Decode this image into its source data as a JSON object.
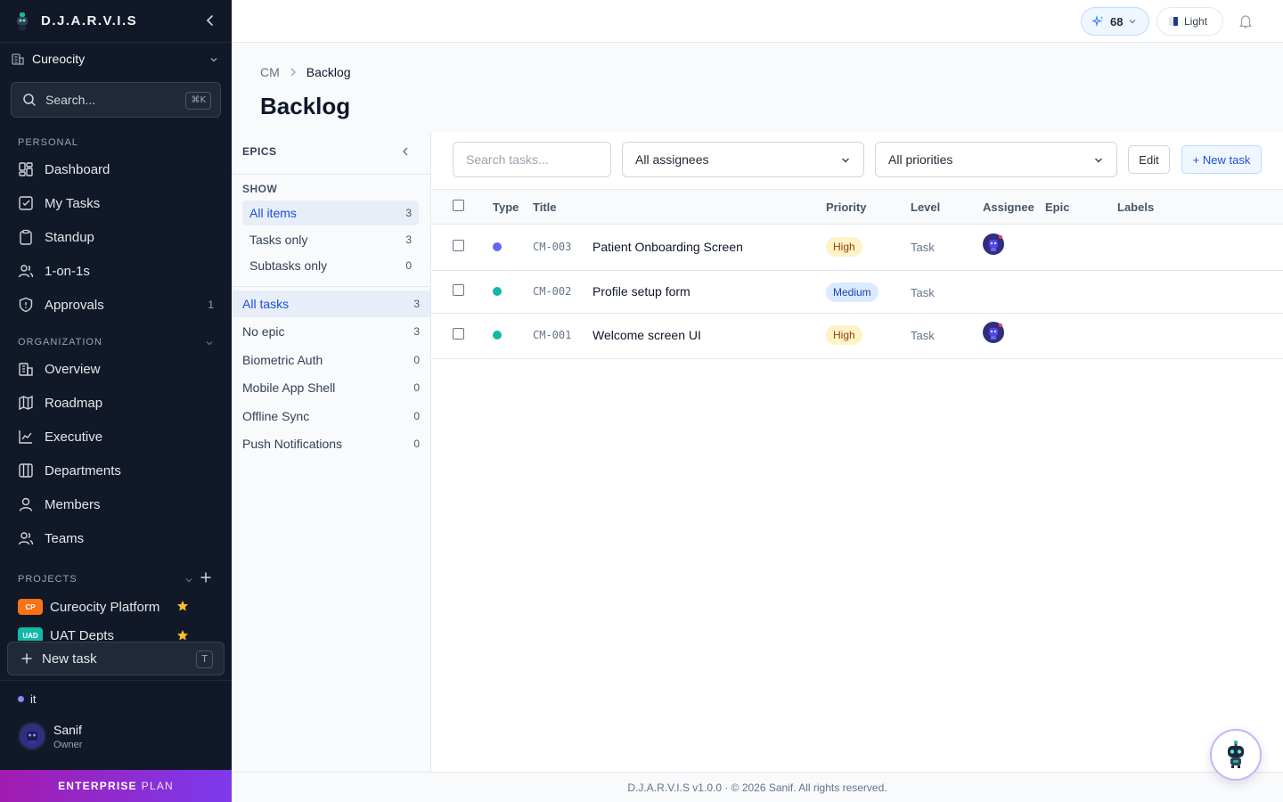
{
  "app": {
    "name": "D.J.A.R.V.I.S"
  },
  "org": {
    "name": "Cureocity"
  },
  "search": {
    "placeholder": "Search...",
    "shortcut": "⌘K"
  },
  "sidebar": {
    "personal_label": "PERSONAL",
    "personal": [
      {
        "label": "Dashboard",
        "icon": "dashboard-icon"
      },
      {
        "label": "My Tasks",
        "icon": "checkbox-icon"
      },
      {
        "label": "Standup",
        "icon": "clipboard-icon"
      },
      {
        "label": "1-on-1s",
        "icon": "users-icon"
      },
      {
        "label": "Approvals",
        "icon": "shield-icon",
        "count": "1"
      }
    ],
    "organization_label": "ORGANIZATION",
    "organization": [
      {
        "label": "Overview",
        "icon": "building-icon"
      },
      {
        "label": "Roadmap",
        "icon": "map-icon"
      },
      {
        "label": "Executive",
        "icon": "chart-line-icon"
      },
      {
        "label": "Departments",
        "icon": "columns-icon"
      },
      {
        "label": "Members",
        "icon": "user-icon"
      },
      {
        "label": "Teams",
        "icon": "users-icon"
      }
    ],
    "projects_label": "PROJECTS",
    "projects": [
      {
        "badge": "CP",
        "name": "Cureocity Platform",
        "color": "#f97316"
      },
      {
        "badge": "UAD",
        "name": "UAT Depts",
        "color": "#14b8a6"
      }
    ],
    "new_task": {
      "label": "New task",
      "shortcut": "T"
    },
    "workspace": "it",
    "user": {
      "name": "Sanif",
      "role": "Owner"
    },
    "plan": {
      "bold": "ENTERPRISE",
      "light": "PLAN"
    }
  },
  "topbar": {
    "credits": "68",
    "theme": "Light"
  },
  "breadcrumb": {
    "root": "CM",
    "current": "Backlog"
  },
  "page": {
    "title": "Backlog"
  },
  "epics": {
    "title": "EPICS",
    "show_label": "SHOW",
    "show": [
      {
        "label": "All items",
        "count": "3",
        "active": true
      },
      {
        "label": "Tasks only",
        "count": "3"
      },
      {
        "label": "Subtasks only",
        "count": "0"
      }
    ],
    "list": [
      {
        "label": "All tasks",
        "count": "3",
        "active": true
      },
      {
        "label": "No epic",
        "count": "3"
      },
      {
        "label": "Biometric Auth",
        "count": "0"
      },
      {
        "label": "Mobile App Shell",
        "count": "0"
      },
      {
        "label": "Offline Sync",
        "count": "0"
      },
      {
        "label": "Push Notifications",
        "count": "0"
      }
    ]
  },
  "filters": {
    "search_placeholder": "Search tasks...",
    "assignees": "All assignees",
    "priorities": "All priorities",
    "edit": "Edit",
    "new_task": "+ New task"
  },
  "table": {
    "headers": {
      "type": "Type",
      "title": "Title",
      "priority": "Priority",
      "level": "Level",
      "assignee": "Assignee",
      "epic": "Epic",
      "labels": "Labels"
    },
    "rows": [
      {
        "id": "CM-003",
        "title": "Patient Onboarding Screen",
        "priority": "High",
        "level": "Task",
        "type_color": "#6366f1",
        "has_assignee": true
      },
      {
        "id": "CM-002",
        "title": "Profile setup form",
        "priority": "Medium",
        "level": "Task",
        "type_color": "#14b8a6",
        "has_assignee": false
      },
      {
        "id": "CM-001",
        "title": "Welcome screen UI",
        "priority": "High",
        "level": "Task",
        "type_color": "#14b8a6",
        "has_assignee": true
      }
    ]
  },
  "footer": {
    "text": "D.J.A.R.V.I.S v1.0.0 · © 2026 Sanif. All rights reserved."
  }
}
